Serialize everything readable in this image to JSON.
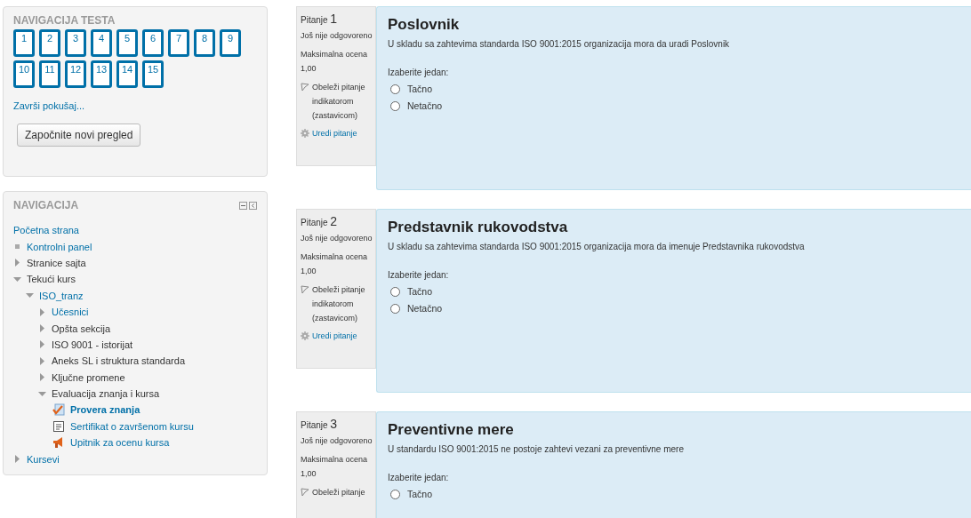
{
  "quiz_navigation": {
    "title": "NAVIGACIJA TESTA",
    "questions": [
      {
        "label": "1"
      },
      {
        "label": "2"
      },
      {
        "label": "3"
      },
      {
        "label": "4"
      },
      {
        "label": "5"
      },
      {
        "label": "6"
      },
      {
        "label": "7"
      },
      {
        "label": "8"
      },
      {
        "label": "9"
      },
      {
        "label": "10"
      },
      {
        "label": "11"
      },
      {
        "label": "12"
      },
      {
        "label": "13"
      },
      {
        "label": "14"
      },
      {
        "label": "15"
      }
    ],
    "finish_link": "Završi pokušaj...",
    "button": "Započnite novi pregled"
  },
  "navigation": {
    "title": "NAVIGACIJA",
    "items": [
      {
        "label": "Početna strana",
        "kind": "plain",
        "link": true
      },
      {
        "label": "Kontrolni panel",
        "kind": "bullet",
        "link": true
      },
      {
        "label": "Stranice sajta",
        "kind": "branch",
        "link": false,
        "expanded": false
      },
      {
        "label": "Tekući kurs",
        "kind": "branch",
        "link": false,
        "expanded": true,
        "children": [
          {
            "label": "ISO_tranz",
            "kind": "branch",
            "link": true,
            "expanded": true,
            "children": [
              {
                "label": "Učesnici",
                "kind": "branch",
                "link": true,
                "expanded": false
              },
              {
                "label": "Opšta sekcija",
                "kind": "branch",
                "link": false,
                "expanded": false
              },
              {
                "label": "ISO 9001 - istorijat",
                "kind": "branch",
                "link": false,
                "expanded": false
              },
              {
                "label": "Aneks SL i struktura standarda",
                "kind": "branch",
                "link": false,
                "expanded": false
              },
              {
                "label": "Ključne promene",
                "kind": "branch",
                "link": false,
                "expanded": false
              },
              {
                "label": "Evaluacija znanja i kursa",
                "kind": "branch",
                "link": false,
                "expanded": true,
                "children": [
                  {
                    "label": "Provera znanja",
                    "kind": "quiz",
                    "link": true,
                    "selected": true
                  },
                  {
                    "label": "Sertifikat o završenom kursu",
                    "kind": "certificate",
                    "link": true,
                    "selected": false
                  },
                  {
                    "label": "Upitnik za ocenu kursa",
                    "kind": "feedback",
                    "link": true,
                    "selected": false
                  }
                ]
              }
            ]
          }
        ]
      },
      {
        "label": "Kursevi",
        "kind": "branch",
        "link": true,
        "expanded": false
      }
    ]
  },
  "questions": [
    {
      "label": "Pitanje",
      "number": "1",
      "state": "Još nije odgovoreno",
      "mark_label": "Maksimalna ocena",
      "mark": "1,00",
      "flag": "Obeleži pitanje indikatorom (zastavicom)",
      "edit": "Uredi pitanje",
      "title": "Poslovnik",
      "text": "U skladu sa zahtevima standarda ISO 9001:2015 organizacija mora da uradi Poslovnik",
      "prompt": "Izaberite jedan:",
      "options": [
        {
          "label": "Tačno",
          "selected": false
        },
        {
          "label": "Netačno",
          "selected": false
        }
      ]
    },
    {
      "label": "Pitanje",
      "number": "2",
      "state": "Još nije odgovoreno",
      "mark_label": "Maksimalna ocena",
      "mark": "1,00",
      "flag": "Obeleži pitanje indikatorom (zastavicom)",
      "edit": "Uredi pitanje",
      "title": "Predstavnik rukovodstva",
      "text": "U skladu sa zahtevima standarda ISO 9001:2015 organizacija mora da imenuje Predstavnika rukovodstva",
      "prompt": "Izaberite jedan:",
      "options": [
        {
          "label": "Tačno",
          "selected": false
        },
        {
          "label": "Netačno",
          "selected": false
        }
      ]
    },
    {
      "label": "Pitanje",
      "number": "3",
      "state": "Još nije odgovoreno",
      "mark_label": "Maksimalna ocena",
      "mark": "1,00",
      "flag": "Obeleži pitanje",
      "title": "Preventivne mere",
      "text": "U standardu ISO 9001:2015 ne postoje zahtevi vezani za preventivne mere",
      "prompt": "Izaberite jedan:",
      "options": [
        {
          "label": "Tačno",
          "selected": false
        }
      ]
    }
  ]
}
